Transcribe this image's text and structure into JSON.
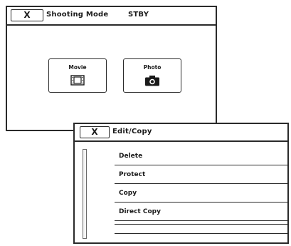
{
  "shooting_mode_screen": {
    "close_label": "X",
    "title": "Shooting Mode",
    "status": "STBY",
    "options": [
      {
        "label": "Movie",
        "icon": "film-icon"
      },
      {
        "label": "Photo",
        "icon": "camera-icon"
      }
    ]
  },
  "edit_copy_screen": {
    "close_label": "X",
    "title": "Edit/Copy",
    "items": [
      "Delete",
      "Protect",
      "Copy",
      "Direct Copy"
    ]
  }
}
